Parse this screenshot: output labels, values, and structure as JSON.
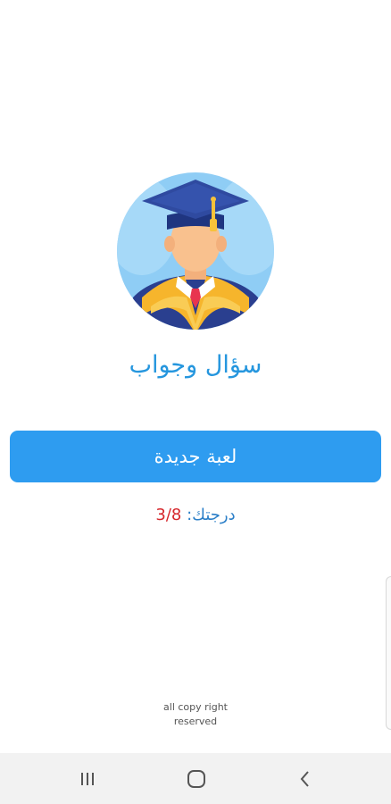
{
  "app": {
    "title": "سؤال وجواب"
  },
  "actions": {
    "new_game_label": "لعبة جديدة"
  },
  "score": {
    "label": "درجتك:",
    "value": "3/8"
  },
  "footer": {
    "copyright_line1": "all copy right",
    "copyright_line2": "reserved"
  },
  "navigation": {
    "recents_icon": "recents-icon",
    "home_icon": "home-icon",
    "back_icon": "back-icon"
  },
  "colors": {
    "primary": "#2e9cf0",
    "title": "#2596de",
    "score_label": "#2b7fc8",
    "score_value": "#d6262b"
  }
}
